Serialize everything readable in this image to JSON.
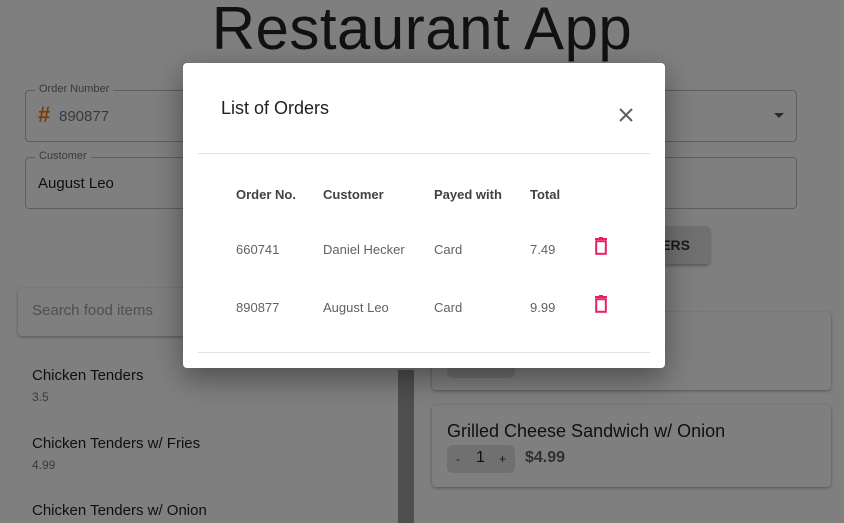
{
  "app": {
    "title": "Restaurant App"
  },
  "form": {
    "order_number": {
      "label": "Order Number",
      "symbol": "#",
      "value": "890877"
    },
    "customer": {
      "label": "Customer",
      "value": "August Leo"
    },
    "orders_button_label": "ders"
  },
  "search": {
    "placeholder": "Search food items"
  },
  "food_items": [
    {
      "name": "Chicken Tenders",
      "price": "3.5"
    },
    {
      "name": "Chicken Tenders w/ Fries",
      "price": "4.99"
    },
    {
      "name": "Chicken Tenders w/ Onion",
      "price": ""
    }
  ],
  "cart": [
    {
      "name": "Grilled Cheese Sandwich w/ Onion",
      "qty": "1",
      "price": "$4.99",
      "minus": "-",
      "plus": "+"
    }
  ],
  "modal": {
    "title": "List of Orders",
    "headers": {
      "order_no": "Order No.",
      "customer": "Customer",
      "payed_with": "Payed with",
      "total": "Total"
    },
    "rows": [
      {
        "order_no": "660741",
        "customer": "Daniel Hecker",
        "payed_with": "Card",
        "total": "7.49"
      },
      {
        "order_no": "890877",
        "customer": "August Leo",
        "payed_with": "Card",
        "total": "9.99"
      }
    ]
  },
  "colors": {
    "accent": "#f57c00",
    "delete": "#e91e63",
    "overlay": "rgba(0,0,0,0.5)"
  },
  "icons": {
    "close": "close-icon",
    "delete": "trash-icon",
    "dropdown": "chevron-down-icon"
  }
}
